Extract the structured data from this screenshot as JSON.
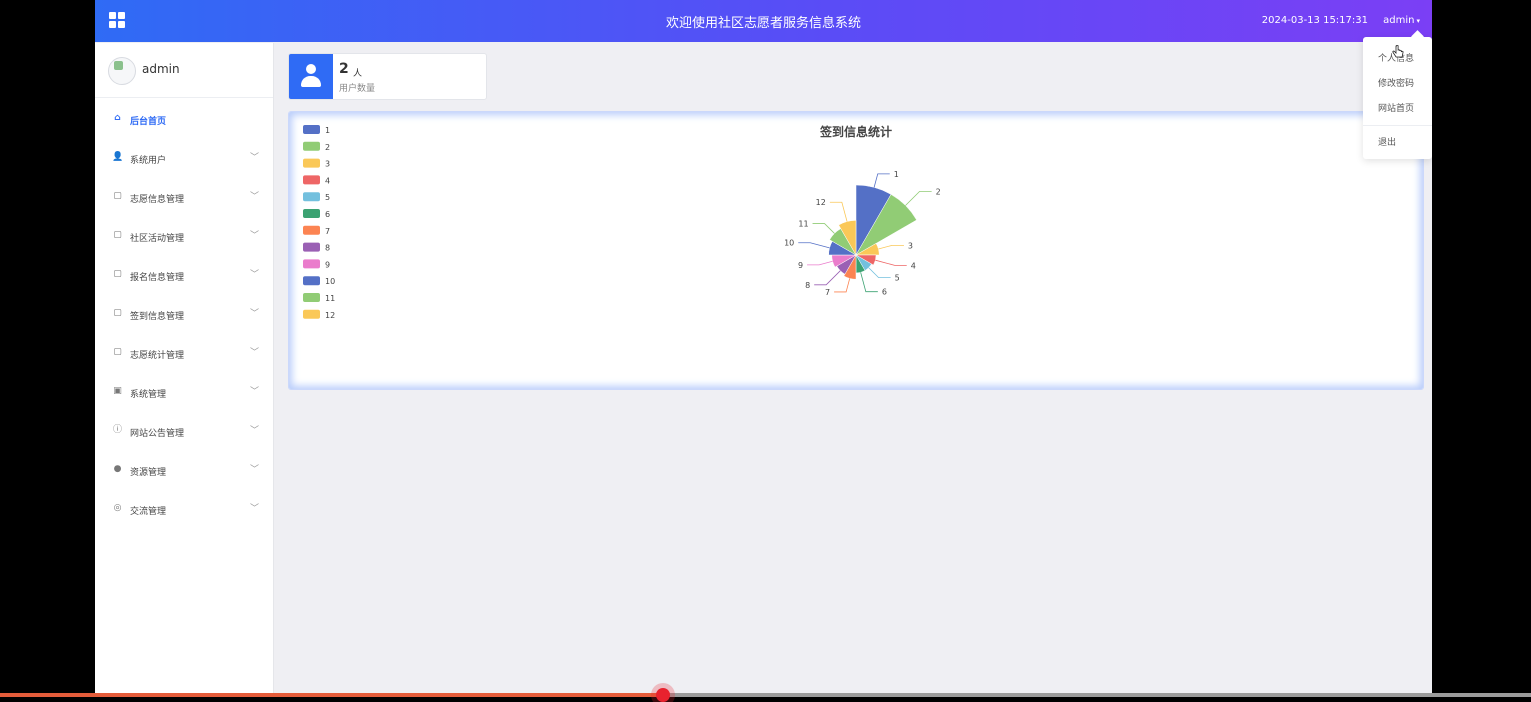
{
  "header": {
    "title": "欢迎使用社区志愿者服务信息系统",
    "datetime": "2024-03-13 15:17:31",
    "user": "admin",
    "user_caret": "▾"
  },
  "sidebar": {
    "username": "admin",
    "items": [
      {
        "label": "后台首页",
        "icon": "home-icon",
        "glyph": "⌂",
        "active": true,
        "arrow": ""
      },
      {
        "label": "系统用户",
        "icon": "user-icon",
        "glyph": "👤",
        "active": false,
        "arrow": "﹀"
      },
      {
        "label": "志愿信息管理",
        "icon": "document-icon",
        "glyph": "▢",
        "active": false,
        "arrow": "﹀"
      },
      {
        "label": "社区活动管理",
        "icon": "document-icon",
        "glyph": "▢",
        "active": false,
        "arrow": "﹀"
      },
      {
        "label": "报名信息管理",
        "icon": "document-icon",
        "glyph": "▢",
        "active": false,
        "arrow": "﹀"
      },
      {
        "label": "签到信息管理",
        "icon": "document-icon",
        "glyph": "▢",
        "active": false,
        "arrow": "﹀"
      },
      {
        "label": "志愿统计管理",
        "icon": "document-icon",
        "glyph": "▢",
        "active": false,
        "arrow": "﹀"
      },
      {
        "label": "系统管理",
        "icon": "image-icon",
        "glyph": "▣",
        "active": false,
        "arrow": "﹀"
      },
      {
        "label": "网站公告管理",
        "icon": "info-icon",
        "glyph": "ⓘ",
        "active": false,
        "arrow": "﹀"
      },
      {
        "label": "资源管理",
        "icon": "pin-icon",
        "glyph": "●",
        "active": false,
        "arrow": "﹀"
      },
      {
        "label": "交流管理",
        "icon": "chat-icon",
        "glyph": "◎",
        "active": false,
        "arrow": "﹀"
      }
    ]
  },
  "stat_card": {
    "value": "2",
    "unit": "人",
    "label": "用户数量",
    "icon": "user-icon"
  },
  "user_menu": {
    "items": [
      "个人信息",
      "修改密码",
      "网站首页"
    ],
    "logout": "退出"
  },
  "video_progress": 0.433,
  "colors": [
    "#5470c6",
    "#91cc75",
    "#fac858",
    "#ee6666",
    "#73c0de",
    "#3ba272",
    "#fc8452",
    "#9a60b4",
    "#ea7ccc",
    "#5470c6",
    "#91cc75",
    "#fac858"
  ],
  "chart_data": {
    "type": "pie",
    "subtype": "rose",
    "title": "签到信息统计",
    "categories": [
      "1",
      "2",
      "3",
      "4",
      "5",
      "6",
      "7",
      "8",
      "9",
      "10",
      "11",
      "12"
    ],
    "values": [
      9,
      9,
      4.5,
      4.2,
      4.0,
      4.0,
      4.6,
      4.4,
      4.6,
      4.9,
      5.2,
      5.6
    ],
    "legend_position": "top-left"
  }
}
